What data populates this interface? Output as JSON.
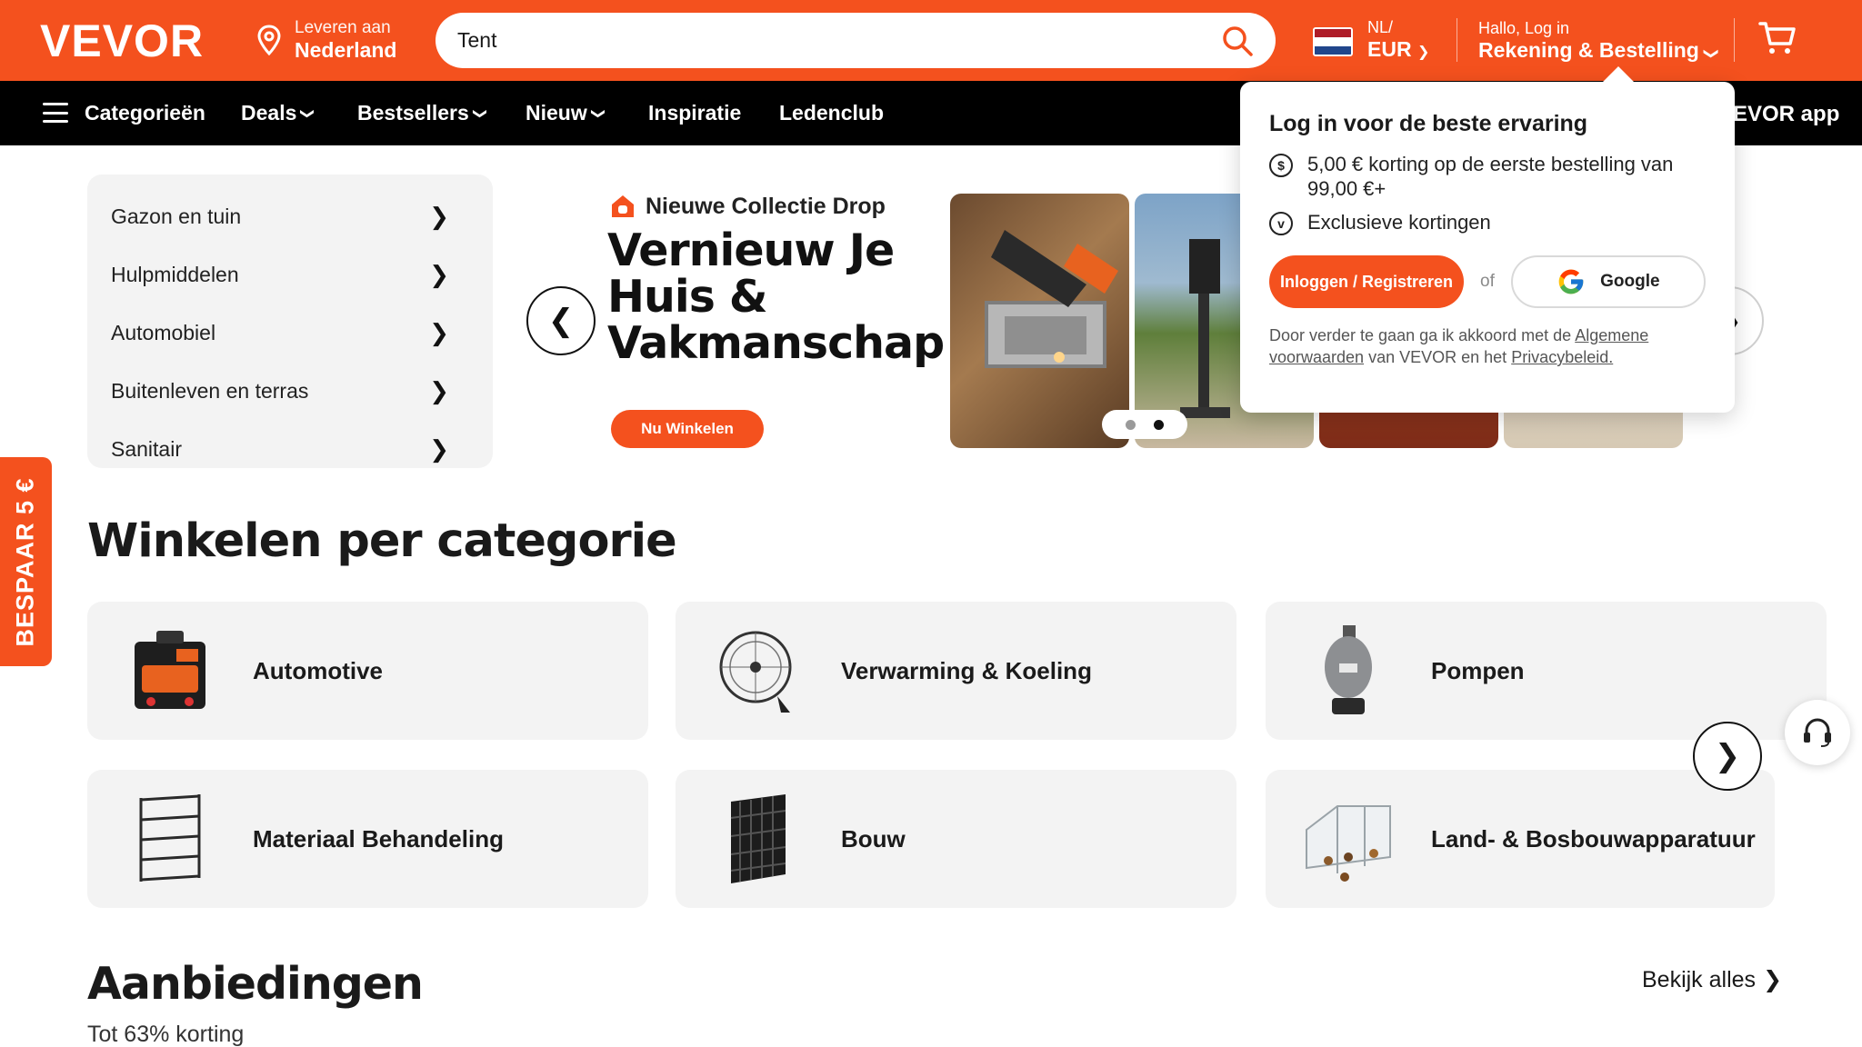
{
  "header": {
    "logo": "VEVOR",
    "deliver_small": "Leveren aan",
    "deliver_big": "Nederland",
    "search_value": "Tent",
    "locale_small": "NL/",
    "locale_big": "EUR",
    "account_small": "Hallo, Log in",
    "account_big": "Rekening & Bestelling"
  },
  "nav": {
    "categories": "Categorieën",
    "deals": "Deals",
    "bestsellers": "Bestsellers",
    "new": "Nieuw",
    "inspiration": "Inspiratie",
    "club": "Ledenclub",
    "app": "EVOR app"
  },
  "sidebar": {
    "items": [
      {
        "label": "Gazon en tuin"
      },
      {
        "label": "Hulpmiddelen"
      },
      {
        "label": "Automobiel"
      },
      {
        "label": "Buitenleven en terras"
      },
      {
        "label": "Sanitair"
      }
    ]
  },
  "hero": {
    "tag": "Nieuwe Collectie Drop",
    "title": "Vernieuw Je Huis & Vakmanschap",
    "button": "Nu Winkelen",
    "active_slide": 2,
    "slide_count": 2
  },
  "popup": {
    "title": "Log in voor de beste ervaring",
    "perk1": "5,00 € korting op de eerste bestelling van 99,00 €+",
    "perk2": "Exclusieve kortingen",
    "login_button": "Inloggen / Registreren",
    "or": "of",
    "google_button": "Google",
    "terms_prefix": "Door verder te gaan ga ik akkoord met de",
    "terms_link": "Algemene voorwaarden",
    "terms_middle": "van VEVOR en het",
    "privacy_link": "Privacybeleid."
  },
  "categories": {
    "title": "Winkelen per categorie",
    "items": [
      {
        "label": "Automotive",
        "icon": "car-jack-kit-icon"
      },
      {
        "label": "Verwarming & Koeling",
        "icon": "wall-fan-icon"
      },
      {
        "label": "Pompen",
        "icon": "sand-filter-pump-icon"
      },
      {
        "label": "Materiaal Behandeling",
        "icon": "shelving-rack-icon"
      },
      {
        "label": "Bouw",
        "icon": "floor-grid-tile-icon"
      },
      {
        "label": "Land- & Bosbouwapparatuur",
        "icon": "chicken-coop-icon"
      }
    ]
  },
  "promo_tab": "BESPAAR 5 €",
  "deals": {
    "title": "Aanbiedingen",
    "subtitle": "Tot 63% korting",
    "view_all": "Bekijk alles"
  },
  "colors": {
    "brand": "#f4511e",
    "nav": "#000000",
    "card_bg": "#f3f3f3"
  }
}
